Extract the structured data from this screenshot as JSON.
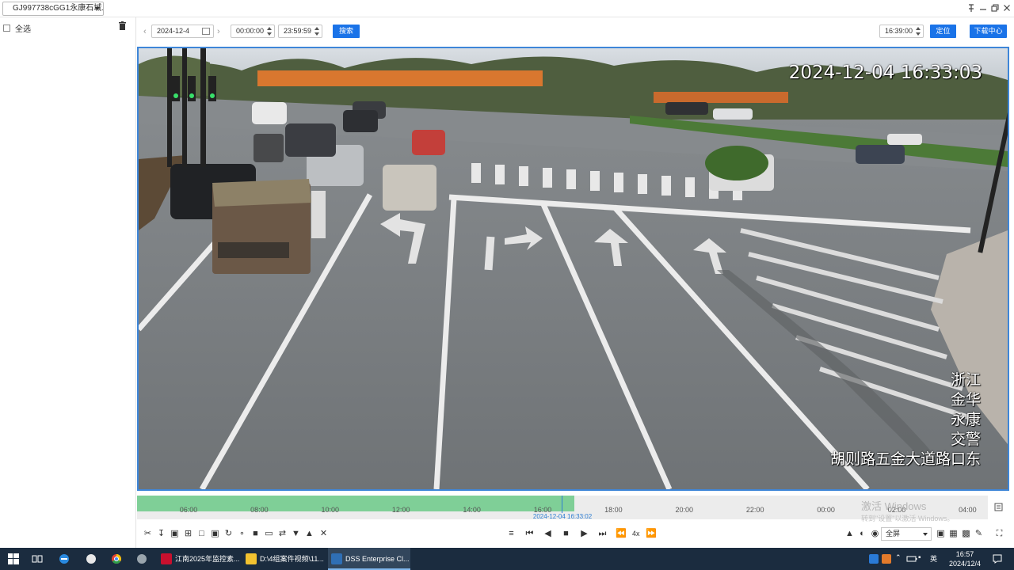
{
  "titlebar": {
    "device_select": "GJ997738cGG1永康石城...",
    "pin_icon": "pin-icon",
    "min_icon": "minimize-icon",
    "restore_icon": "restore-icon",
    "close_icon": "close-icon"
  },
  "left_panel": {
    "select_all_label": "全选"
  },
  "toolbar": {
    "date": "2024-12-4",
    "start_time": "00:00:00",
    "end_time": "23:59:59",
    "search_label": "搜索",
    "locate_time": "16:39:00",
    "locate_label": "定位",
    "download_center_label": "下载中心"
  },
  "video": {
    "osd_timestamp": "2024-12-04 16:33:03",
    "osd_location_lines": [
      "浙江",
      "金华",
      "永康",
      "交警"
    ],
    "osd_road": "胡则路五金大道路口东"
  },
  "timeline": {
    "ticks": [
      "06:00",
      "08:00",
      "10:00",
      "12:00",
      "14:00",
      "16:00",
      "18:00",
      "20:00",
      "22:00",
      "00:00",
      "02:00",
      "04:00"
    ],
    "current_label": "2024-12-04 16:33:02",
    "recorded_fraction": 0.514,
    "cursor_fraction": 0.5
  },
  "activation_watermark": {
    "line1": "激活 Windows",
    "line2": "转到\"设置\"以激活 Windows。"
  },
  "controls": {
    "speed_label": "4x",
    "fullscreen_select": "全屏"
  },
  "taskbar": {
    "apps": [
      {
        "label": "江南2025年监控素...",
        "color": "#c8102e"
      },
      {
        "label": "D:\\4组案件视频\\11...",
        "color": "#f2c230"
      },
      {
        "label": "DSS Enterprise Cl...",
        "color": "#2f6fb5"
      }
    ],
    "ime_label": "英",
    "clock_time": "16:57",
    "clock_date": "2024/12/4"
  },
  "colors": {
    "accent": "#1a73e8",
    "video_border": "#3e86d8",
    "timeline_recorded": "#7fcf97",
    "taskbar_bg": "#1b2c3f"
  }
}
